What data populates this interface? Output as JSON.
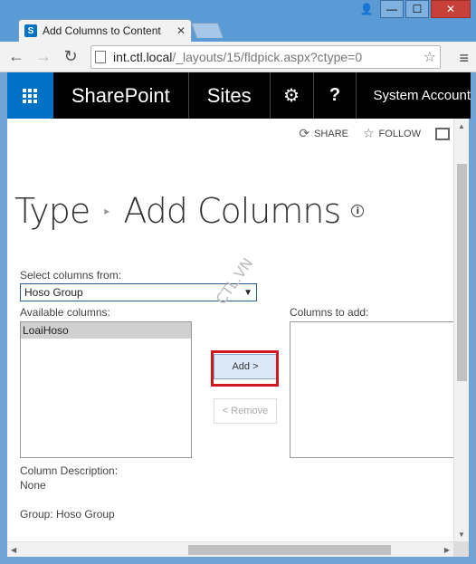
{
  "browser": {
    "tab_title": "Add Columns to Content",
    "tab_icon_letter": "S",
    "url_host": "int.ctl.local",
    "url_path": "/_layouts/15/fldpick.aspx?ctype=0",
    "window_buttons": {
      "user": "👤",
      "minimize": "—",
      "maximize": "☐",
      "close": "✕"
    }
  },
  "suite_bar": {
    "brand": "SharePoint",
    "sites": "Sites",
    "settings_icon": "⚙",
    "help_icon": "?",
    "account": "System Account"
  },
  "actions": {
    "share": "SHARE",
    "follow": "FOLLOW"
  },
  "page": {
    "breadcrumb_parent": "Type",
    "breadcrumb_separator": "▸",
    "title": "Add Columns",
    "info_icon": "i"
  },
  "form": {
    "select_from_label": "Select columns from:",
    "select_from_value": "Hoso Group",
    "available_label": "Available columns:",
    "available_items": [
      "LoaiHoso"
    ],
    "columns_to_add_label": "Columns to add:",
    "add_button": "Add >",
    "remove_button": "< Remove",
    "description_label": "Column Description:",
    "description_value": "None",
    "group_text": "Group: Hoso Group"
  },
  "watermark": "CTL.VN",
  "colors": {
    "accent": "#0072c6",
    "suite_bar": "#000000",
    "highlight": "#d0161f"
  }
}
